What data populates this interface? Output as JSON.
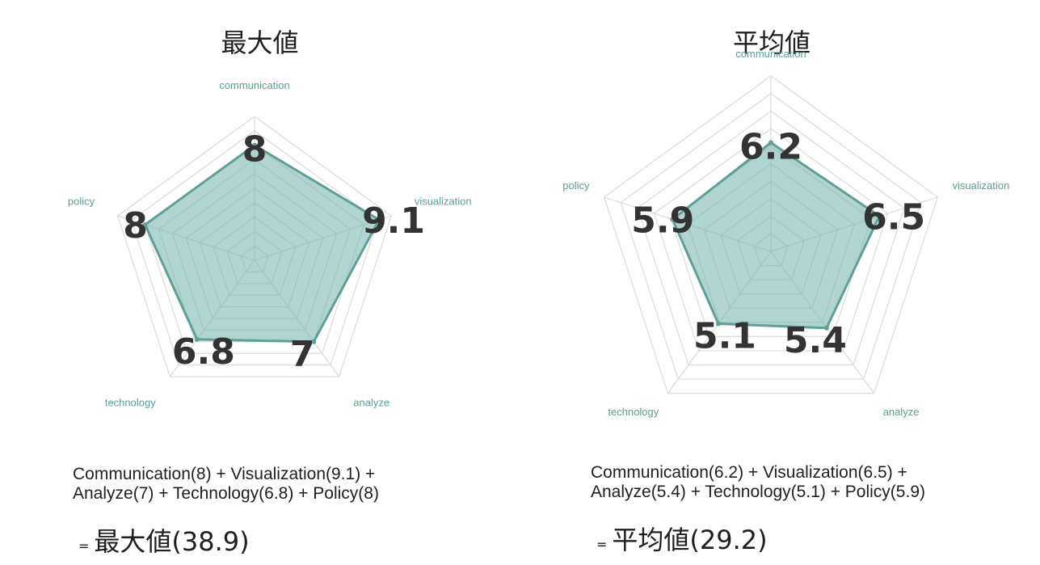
{
  "colors": {
    "grid": "#dddddd",
    "fill": "#6fb2ab",
    "stroke": "#5e9f97",
    "axis_label": "#5a9f96",
    "value_label": "#333333"
  },
  "chart_data": [
    {
      "type": "radar",
      "title": "最大値",
      "axes": [
        "communication",
        "visualization",
        "analyze",
        "technology",
        "policy"
      ],
      "values": [
        8,
        9.1,
        7,
        6.8,
        8
      ],
      "value_labels": [
        "8",
        "9.1",
        "7",
        "6.8",
        "8"
      ],
      "range": [
        0,
        10
      ],
      "rings": 10,
      "grid": true,
      "formula": [
        "Communication(8) + Visualization(9.1) +",
        "Analyze(7) + Technology(6.8) + Policy(8)"
      ],
      "result_eq": "=",
      "result": "最大値(38.9)"
    },
    {
      "type": "radar",
      "title": "平均値",
      "axes": [
        "communication",
        "visualization",
        "analyze",
        "technology",
        "policy"
      ],
      "values": [
        6.2,
        6.5,
        5.4,
        5.1,
        5.9
      ],
      "value_labels": [
        "6.2",
        "6.5",
        "5.4",
        "5.1",
        "5.9"
      ],
      "range": [
        0,
        10
      ],
      "rings": 10,
      "grid": true,
      "formula": [
        "Communication(6.2) + Visualization(6.5) +",
        "Analyze(5.4) + Technology(5.1) + Policy(5.9)"
      ],
      "result_eq": "=",
      "result": "平均値(29.2)"
    }
  ]
}
